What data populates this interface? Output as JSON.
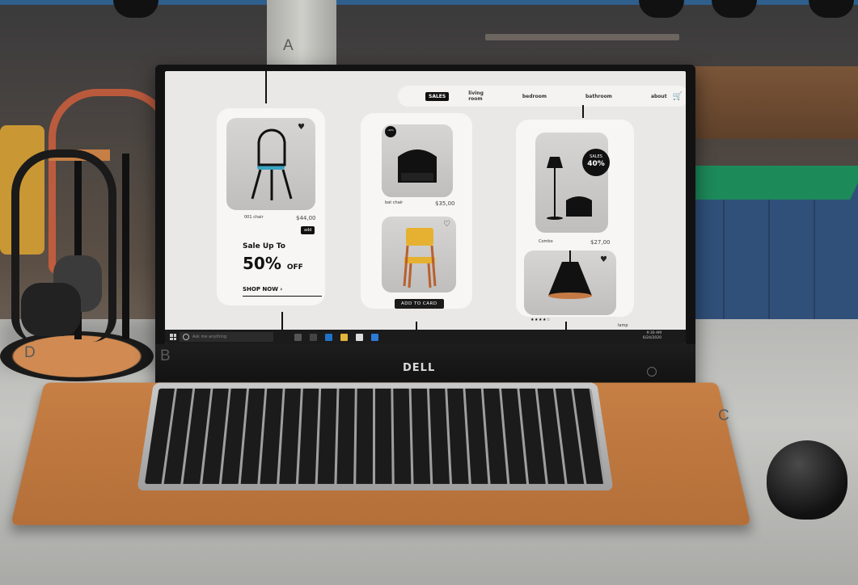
{
  "labels": {
    "A": "A",
    "B": "B",
    "C": "C",
    "D": "D"
  },
  "monitor": {
    "brand": "DELL"
  },
  "nav": {
    "sale": "SALES",
    "items": [
      "living room",
      "bedroom",
      "bathroom",
      "about"
    ]
  },
  "products": [
    {
      "name": "001 chair",
      "price": "$44,00",
      "add": "add"
    },
    {
      "name": "bat chair",
      "price": "$35,00"
    },
    {
      "name": "Combo",
      "price": "$27,00"
    },
    {
      "name": "lamp"
    }
  ],
  "promo": {
    "line1": "Sale Up To",
    "line2": "50%",
    "line3": "OFF",
    "cta": "SHOP NOW"
  },
  "badges": {
    "small": "-20%",
    "sale_label": "SALES",
    "sale_value": "40%"
  },
  "buttons": {
    "add_to_card": "ADD TO CARD"
  },
  "rating": "★★★★☆",
  "taskbar": {
    "search_placeholder": "Ask me anything",
    "time": "9:30 AM",
    "date": "6/24/2020"
  },
  "colors": {
    "accent": "#111111",
    "tray": "#c67f44",
    "taskbar": "#1b1b1b"
  }
}
